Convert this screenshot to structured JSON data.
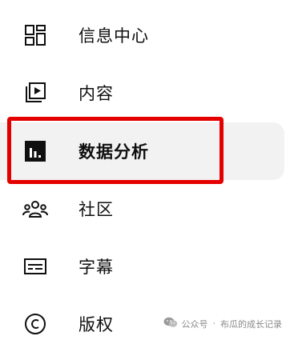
{
  "sidebar": {
    "items": [
      {
        "label": "信息中心",
        "icon": "dashboard-icon"
      },
      {
        "label": "内容",
        "icon": "content-video-icon"
      },
      {
        "label": "数据分析",
        "icon": "analytics-icon",
        "active": true
      },
      {
        "label": "社区",
        "icon": "community-icon"
      },
      {
        "label": "字幕",
        "icon": "subtitles-icon"
      },
      {
        "label": "版权",
        "icon": "copyright-icon"
      }
    ]
  },
  "annotation": {
    "highlight_color": "#e50000"
  },
  "watermark": {
    "icon": "wechat-icon",
    "prefix": "公众号",
    "separator": "·",
    "author": "布瓜的成长记录"
  }
}
